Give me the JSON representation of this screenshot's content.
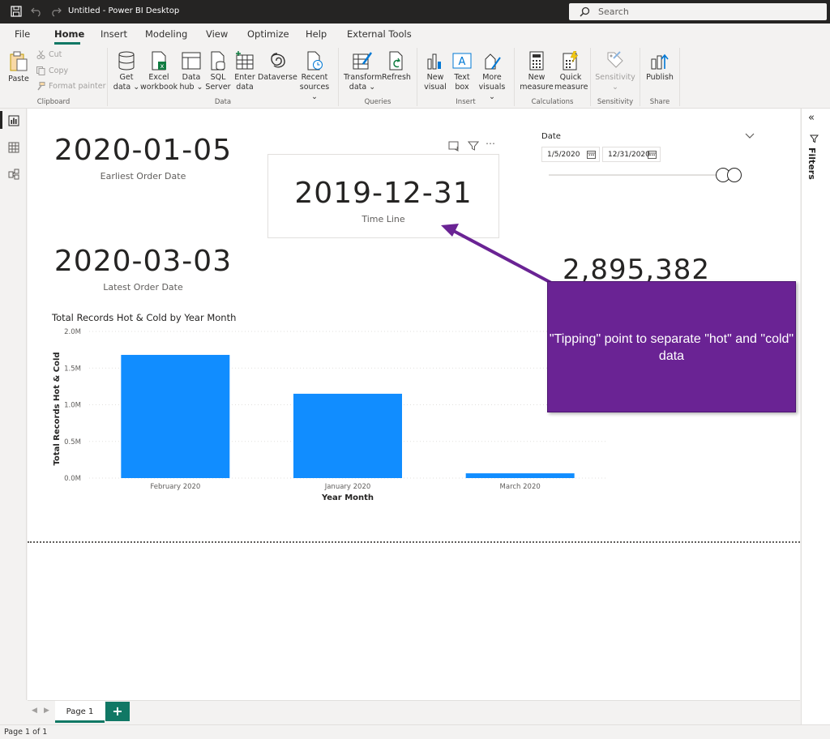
{
  "app": {
    "title": "Untitled - Power BI Desktop",
    "search_label": "Search"
  },
  "menu": [
    "File",
    "Home",
    "Insert",
    "Modeling",
    "View",
    "Optimize",
    "Help",
    "External Tools"
  ],
  "ribbon": {
    "clipboard": {
      "paste": "Paste",
      "cut": "Cut",
      "copy": "Copy",
      "format_painter": "Format painter",
      "group": "Clipboard"
    },
    "data": {
      "get_data": [
        "Get",
        "data ⌄"
      ],
      "excel": [
        "Excel",
        "workbook"
      ],
      "data_hub": [
        "Data",
        "hub ⌄"
      ],
      "sql": [
        "SQL",
        "Server"
      ],
      "enter_data": [
        "Enter",
        "data"
      ],
      "dataverse": [
        "Dataverse",
        ""
      ],
      "recent": [
        "Recent",
        "sources ⌄"
      ],
      "group": "Data"
    },
    "queries": {
      "transform": [
        "Transform",
        "data ⌄"
      ],
      "refresh": [
        "Refresh",
        ""
      ],
      "group": "Queries"
    },
    "insert": {
      "new_visual": [
        "New",
        "visual"
      ],
      "text_box": [
        "Text",
        "box"
      ],
      "more_visuals": [
        "More",
        "visuals ⌄"
      ],
      "group": "Insert"
    },
    "calculations": {
      "new_measure": [
        "New",
        "measure"
      ],
      "quick_measure": [
        "Quick",
        "measure"
      ],
      "group": "Calculations"
    },
    "sensitivity": {
      "label": [
        "Sensitivity",
        "⌄"
      ],
      "group": "Sensitivity"
    },
    "share": {
      "publish": [
        "Publish",
        ""
      ],
      "group": "Share"
    }
  },
  "canvas": {
    "card1": {
      "value": "2020-01-05",
      "label": "Earliest Order Date"
    },
    "card2": {
      "value": "2020-03-03",
      "label": "Latest Order Date"
    },
    "card3": {
      "value": "2019-12-31",
      "label": "Time Line"
    },
    "card4": {
      "value": "2,895,382"
    },
    "slicer": {
      "title": "Date",
      "start": "1/5/2020",
      "end": "12/31/2020",
      "start_level": 0.95,
      "end_level": 1.0
    },
    "callout": "\"Tipping\" point to separate \"hot\" and \"cold\" data"
  },
  "chart_data": {
    "type": "bar",
    "title": "Total Records Hot & Cold by Year Month",
    "xlabel": "Year Month",
    "ylabel": "Total Records Hot & Cold",
    "categories": [
      "February 2020",
      "January 2020",
      "March 2020"
    ],
    "values": [
      1680000,
      1150000,
      65000
    ],
    "ylim": [
      0,
      2000000
    ],
    "yticks": [
      "0.0M",
      "0.5M",
      "1.0M",
      "1.5M",
      "2.0M"
    ],
    "grid": true,
    "color": "#118dff"
  },
  "pages": {
    "tab": "Page 1",
    "add": "+"
  },
  "right_pane": {
    "filters": "Filters"
  },
  "status": "Page 1 of 1"
}
